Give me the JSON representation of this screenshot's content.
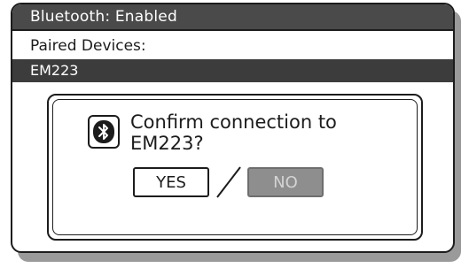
{
  "header": {
    "title": "Bluetooth: Enabled"
  },
  "paired": {
    "label": "Paired Devices:",
    "devices": [
      {
        "name": "EM223",
        "selected": true
      }
    ]
  },
  "dialog": {
    "icon": "bluetooth-icon",
    "message_line1": "Confirm connection to",
    "message_line2": "EM223?",
    "yes_label": "YES",
    "no_label": "NO",
    "separator": "/"
  },
  "colors": {
    "title_bar": "#4a4a4a",
    "selected_row": "#3c3c3c",
    "disabled_button": "#8e8e8e",
    "outline": "#1c1c1c"
  }
}
